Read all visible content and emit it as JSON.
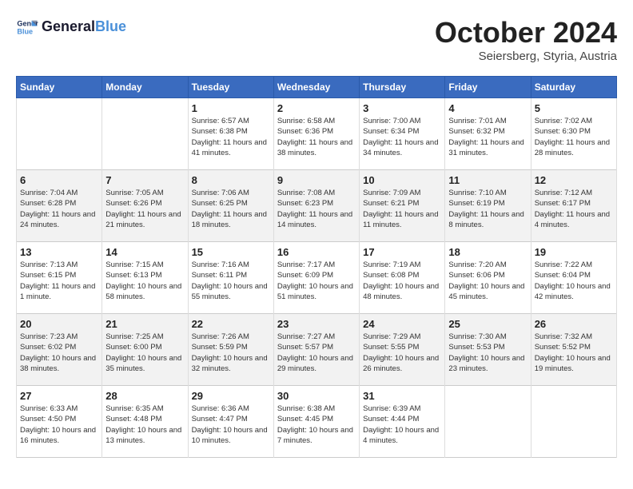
{
  "header": {
    "logo": "GeneralBlue",
    "month": "October 2024",
    "location": "Seiersberg, Styria, Austria"
  },
  "weekdays": [
    "Sunday",
    "Monday",
    "Tuesday",
    "Wednesday",
    "Thursday",
    "Friday",
    "Saturday"
  ],
  "weeks": [
    [
      {
        "day": "",
        "info": ""
      },
      {
        "day": "",
        "info": ""
      },
      {
        "day": "1",
        "info": "Sunrise: 6:57 AM\nSunset: 6:38 PM\nDaylight: 11 hours and 41 minutes."
      },
      {
        "day": "2",
        "info": "Sunrise: 6:58 AM\nSunset: 6:36 PM\nDaylight: 11 hours and 38 minutes."
      },
      {
        "day": "3",
        "info": "Sunrise: 7:00 AM\nSunset: 6:34 PM\nDaylight: 11 hours and 34 minutes."
      },
      {
        "day": "4",
        "info": "Sunrise: 7:01 AM\nSunset: 6:32 PM\nDaylight: 11 hours and 31 minutes."
      },
      {
        "day": "5",
        "info": "Sunrise: 7:02 AM\nSunset: 6:30 PM\nDaylight: 11 hours and 28 minutes."
      }
    ],
    [
      {
        "day": "6",
        "info": "Sunrise: 7:04 AM\nSunset: 6:28 PM\nDaylight: 11 hours and 24 minutes."
      },
      {
        "day": "7",
        "info": "Sunrise: 7:05 AM\nSunset: 6:26 PM\nDaylight: 11 hours and 21 minutes."
      },
      {
        "day": "8",
        "info": "Sunrise: 7:06 AM\nSunset: 6:25 PM\nDaylight: 11 hours and 18 minutes."
      },
      {
        "day": "9",
        "info": "Sunrise: 7:08 AM\nSunset: 6:23 PM\nDaylight: 11 hours and 14 minutes."
      },
      {
        "day": "10",
        "info": "Sunrise: 7:09 AM\nSunset: 6:21 PM\nDaylight: 11 hours and 11 minutes."
      },
      {
        "day": "11",
        "info": "Sunrise: 7:10 AM\nSunset: 6:19 PM\nDaylight: 11 hours and 8 minutes."
      },
      {
        "day": "12",
        "info": "Sunrise: 7:12 AM\nSunset: 6:17 PM\nDaylight: 11 hours and 4 minutes."
      }
    ],
    [
      {
        "day": "13",
        "info": "Sunrise: 7:13 AM\nSunset: 6:15 PM\nDaylight: 11 hours and 1 minute."
      },
      {
        "day": "14",
        "info": "Sunrise: 7:15 AM\nSunset: 6:13 PM\nDaylight: 10 hours and 58 minutes."
      },
      {
        "day": "15",
        "info": "Sunrise: 7:16 AM\nSunset: 6:11 PM\nDaylight: 10 hours and 55 minutes."
      },
      {
        "day": "16",
        "info": "Sunrise: 7:17 AM\nSunset: 6:09 PM\nDaylight: 10 hours and 51 minutes."
      },
      {
        "day": "17",
        "info": "Sunrise: 7:19 AM\nSunset: 6:08 PM\nDaylight: 10 hours and 48 minutes."
      },
      {
        "day": "18",
        "info": "Sunrise: 7:20 AM\nSunset: 6:06 PM\nDaylight: 10 hours and 45 minutes."
      },
      {
        "day": "19",
        "info": "Sunrise: 7:22 AM\nSunset: 6:04 PM\nDaylight: 10 hours and 42 minutes."
      }
    ],
    [
      {
        "day": "20",
        "info": "Sunrise: 7:23 AM\nSunset: 6:02 PM\nDaylight: 10 hours and 38 minutes."
      },
      {
        "day": "21",
        "info": "Sunrise: 7:25 AM\nSunset: 6:00 PM\nDaylight: 10 hours and 35 minutes."
      },
      {
        "day": "22",
        "info": "Sunrise: 7:26 AM\nSunset: 5:59 PM\nDaylight: 10 hours and 32 minutes."
      },
      {
        "day": "23",
        "info": "Sunrise: 7:27 AM\nSunset: 5:57 PM\nDaylight: 10 hours and 29 minutes."
      },
      {
        "day": "24",
        "info": "Sunrise: 7:29 AM\nSunset: 5:55 PM\nDaylight: 10 hours and 26 minutes."
      },
      {
        "day": "25",
        "info": "Sunrise: 7:30 AM\nSunset: 5:53 PM\nDaylight: 10 hours and 23 minutes."
      },
      {
        "day": "26",
        "info": "Sunrise: 7:32 AM\nSunset: 5:52 PM\nDaylight: 10 hours and 19 minutes."
      }
    ],
    [
      {
        "day": "27",
        "info": "Sunrise: 6:33 AM\nSunset: 4:50 PM\nDaylight: 10 hours and 16 minutes."
      },
      {
        "day": "28",
        "info": "Sunrise: 6:35 AM\nSunset: 4:48 PM\nDaylight: 10 hours and 13 minutes."
      },
      {
        "day": "29",
        "info": "Sunrise: 6:36 AM\nSunset: 4:47 PM\nDaylight: 10 hours and 10 minutes."
      },
      {
        "day": "30",
        "info": "Sunrise: 6:38 AM\nSunset: 4:45 PM\nDaylight: 10 hours and 7 minutes."
      },
      {
        "day": "31",
        "info": "Sunrise: 6:39 AM\nSunset: 4:44 PM\nDaylight: 10 hours and 4 minutes."
      },
      {
        "day": "",
        "info": ""
      },
      {
        "day": "",
        "info": ""
      }
    ]
  ]
}
